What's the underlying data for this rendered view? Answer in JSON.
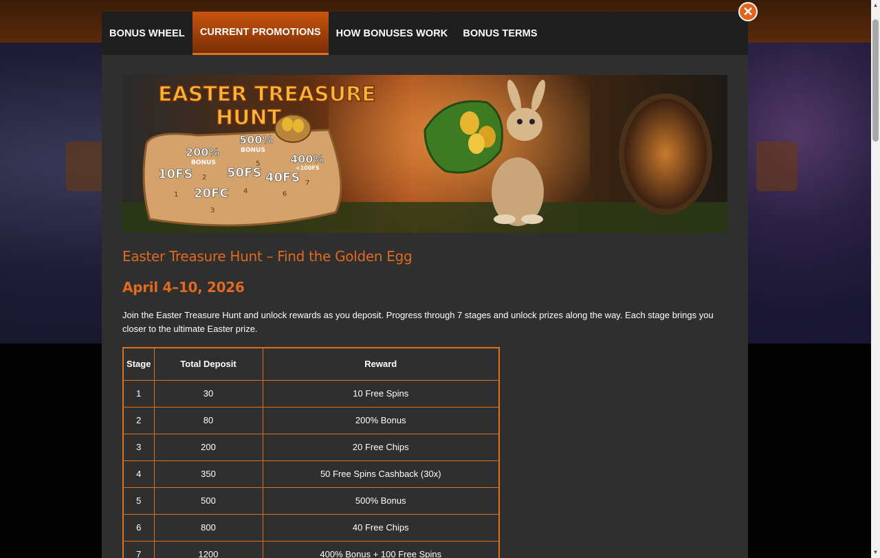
{
  "tabs": [
    {
      "label": "BONUS WHEEL",
      "active": false
    },
    {
      "label": "CURRENT PROMOTIONS",
      "active": true
    },
    {
      "label": "HOW BONUSES WORK",
      "active": false
    },
    {
      "label": "BONUS TERMS",
      "active": false
    }
  ],
  "banner": {
    "headline_line1": "EASTER TREASURE",
    "headline_line2": "HUNT",
    "map_labels": [
      "200%",
      "BONUS",
      "500%",
      "BONUS",
      "10FS",
      "50FS",
      "40FS",
      "400%",
      "+100FS",
      "20FC"
    ],
    "map_numbers": [
      "1",
      "2",
      "3",
      "4",
      "5",
      "6",
      "7"
    ]
  },
  "promo": {
    "title": "Easter Treasure Hunt – Find the Golden Egg",
    "dates": "April 4–10, 2026",
    "description": "Join the Easter Treasure Hunt and unlock rewards as you deposit. Progress through 7 stages and unlock prizes along the way. Each stage brings you closer to the ultimate Easter prize."
  },
  "table": {
    "headers": [
      "Stage",
      "Total Deposit",
      "Reward"
    ],
    "rows": [
      [
        "1",
        "30",
        "10 Free Spins"
      ],
      [
        "2",
        "80",
        "200% Bonus"
      ],
      [
        "3",
        "200",
        "20 Free Chips"
      ],
      [
        "4",
        "350",
        "50 Free Spins Cashback (30x)"
      ],
      [
        "5",
        "500",
        "500% Bonus"
      ],
      [
        "6",
        "800",
        "40 Free Chips"
      ],
      [
        "7",
        "1200",
        "400% Bonus + 100 Free Spins"
      ]
    ]
  },
  "close": {
    "glyph": "✕",
    "icon": "close-icon"
  },
  "colors": {
    "accent": "#e06a1f",
    "tab_active": "#c9540f",
    "modal_bg": "#2f2f2f",
    "tabs_bg": "#1f1f1f"
  }
}
